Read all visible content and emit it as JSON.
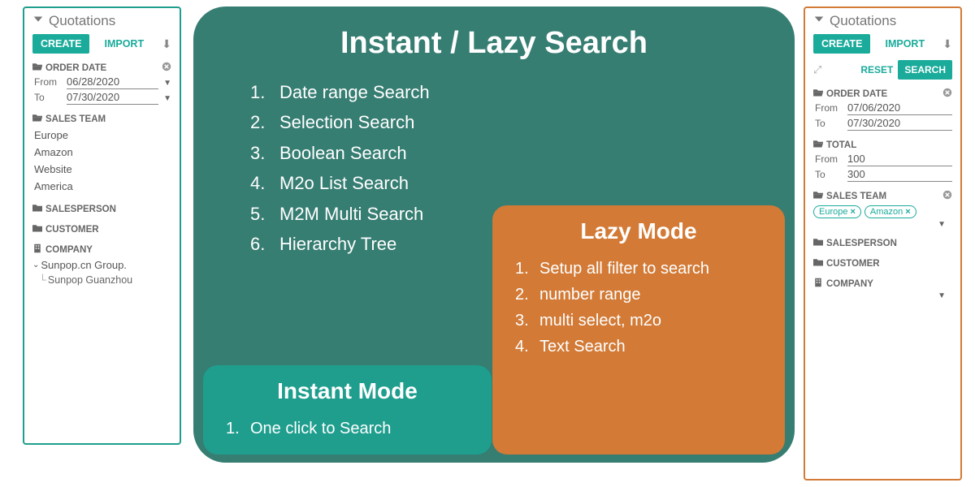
{
  "left": {
    "title": "Quotations",
    "create": "CREATE",
    "import": "IMPORT",
    "order_date": {
      "label": "ORDER DATE",
      "from_lbl": "From",
      "to_lbl": "To",
      "from": "06/28/2020",
      "to": "07/30/2020"
    },
    "sales_team": {
      "label": "SALES TEAM",
      "items": [
        "Europe",
        "Amazon",
        "Website",
        "America"
      ]
    },
    "salesperson": "SALESPERSON",
    "customer": "CUSTOMER",
    "company": "COMPANY",
    "tree": {
      "parent": "Sunpop.cn Group.",
      "child": "Sunpop Guanzhou"
    }
  },
  "right": {
    "title": "Quotations",
    "create": "CREATE",
    "import": "IMPORT",
    "reset": "RESET",
    "search": "SEARCH",
    "order_date": {
      "label": "ORDER DATE",
      "from_lbl": "From",
      "to_lbl": "To",
      "from": "07/06/2020",
      "to": "07/30/2020"
    },
    "total": {
      "label": "TOTAL",
      "from_lbl": "From",
      "to_lbl": "To",
      "from": "100",
      "to": "300"
    },
    "sales_team": {
      "label": "SALES TEAM",
      "chips": [
        "Europe",
        "Amazon"
      ]
    },
    "salesperson": "SALESPERSON",
    "customer": "CUSTOMER",
    "company": "COMPANY"
  },
  "center": {
    "title": "Instant / Lazy Search",
    "features": [
      "Date range Search",
      "Selection Search",
      "Boolean Search",
      "M2o List Search",
      "M2M Multi Search",
      "Hierarchy Tree"
    ],
    "instant": {
      "title": "Instant Mode",
      "items": [
        "One click to Search"
      ]
    },
    "lazy": {
      "title": "Lazy Mode",
      "items": [
        "Setup all filter to search",
        "number range",
        "multi select, m2o",
        "Text Search"
      ]
    }
  }
}
